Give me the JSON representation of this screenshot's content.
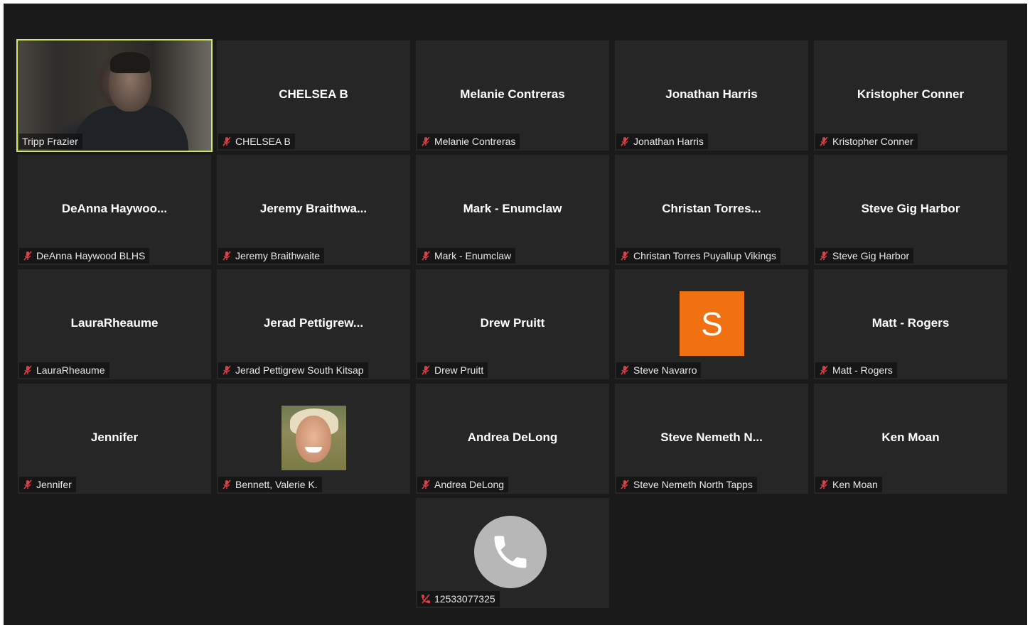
{
  "colors": {
    "background": "#1a1a1a",
    "tile": "#262626",
    "active_speaker_border": "#d2e66a",
    "muted_icon": "#e0404a",
    "avatar_orange": "#f07012"
  },
  "participants": [
    {
      "title": "",
      "name": "Tripp Frazier",
      "muted": false,
      "kind": "video"
    },
    {
      "title": "CHELSEA B",
      "name": "CHELSEA B",
      "muted": true,
      "kind": "name"
    },
    {
      "title": "Melanie Contreras",
      "name": "Melanie Contreras",
      "muted": true,
      "kind": "name"
    },
    {
      "title": "Jonathan Harris",
      "name": "Jonathan Harris",
      "muted": true,
      "kind": "name"
    },
    {
      "title": "Kristopher Conner",
      "name": "Kristopher Conner",
      "muted": true,
      "kind": "name"
    },
    {
      "title": "DeAnna  Haywoo...",
      "name": "DeAnna Haywood BLHS",
      "muted": true,
      "kind": "name"
    },
    {
      "title": "Jeremy  Braithwa...",
      "name": "Jeremy Braithwaite",
      "muted": true,
      "kind": "name"
    },
    {
      "title": "Mark - Enumclaw",
      "name": "Mark - Enumclaw",
      "muted": true,
      "kind": "name"
    },
    {
      "title": "Christan  Torres...",
      "name": "Christan Torres Puyallup Vikings",
      "muted": true,
      "kind": "name"
    },
    {
      "title": "Steve Gig Harbor",
      "name": "Steve Gig Harbor",
      "muted": true,
      "kind": "name"
    },
    {
      "title": "LauraRheaume",
      "name": "LauraRheaume",
      "muted": true,
      "kind": "name"
    },
    {
      "title": "Jerad  Pettigrew...",
      "name": "Jerad Pettigrew South Kitsap",
      "muted": true,
      "kind": "name"
    },
    {
      "title": "Drew Pruitt",
      "name": "Drew Pruitt",
      "muted": true,
      "kind": "name"
    },
    {
      "title": "S",
      "name": "Steve Navarro",
      "muted": true,
      "kind": "initial"
    },
    {
      "title": "Matt - Rogers",
      "name": "Matt - Rogers",
      "muted": true,
      "kind": "name"
    },
    {
      "title": "Jennifer",
      "name": "Jennifer",
      "muted": true,
      "kind": "name"
    },
    {
      "title": "",
      "name": "Bennett, Valerie K.",
      "muted": true,
      "kind": "photo"
    },
    {
      "title": "Andrea DeLong",
      "name": "Andrea DeLong",
      "muted": true,
      "kind": "name"
    },
    {
      "title": "Steve  Nemeth  N...",
      "name": "Steve Nemeth North Tapps",
      "muted": true,
      "kind": "name"
    },
    {
      "title": "Ken Moan",
      "name": "Ken Moan",
      "muted": true,
      "kind": "name"
    },
    {
      "title": "",
      "name": "12533077325",
      "muted": true,
      "kind": "phone"
    }
  ]
}
